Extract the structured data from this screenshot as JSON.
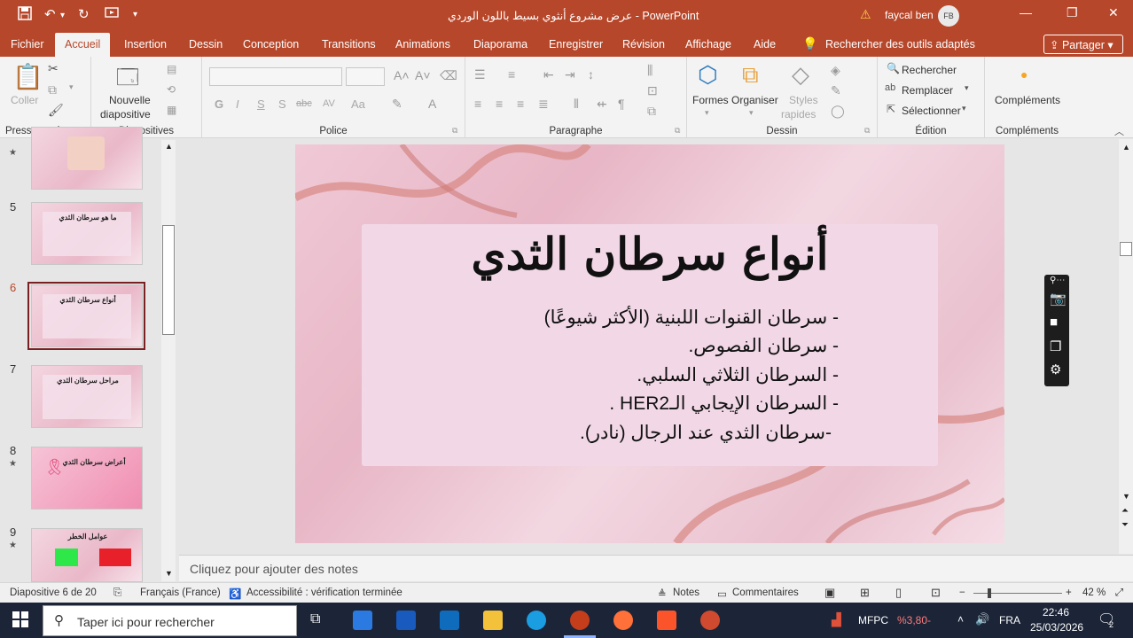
{
  "title_bar": {
    "title": "عرض مشروع أنثوي بسيط باللون الوردي  -  PowerPoint",
    "user_name": "faycal ben",
    "avatar_initials": "FB",
    "icons": [
      "save-icon",
      "undo-icon",
      "redo-icon",
      "present-icon",
      "customize-icon",
      "warning-icon",
      "minimize-icon",
      "restore-icon",
      "close-icon"
    ]
  },
  "tabs": {
    "items": [
      "Fichier",
      "Accueil",
      "Insertion",
      "Dessin",
      "Conception",
      "Transitions",
      "Animations",
      "Diaporama",
      "Enregistrer",
      "Révision",
      "Affichage",
      "Aide"
    ],
    "active": "Accueil",
    "search": "Rechercher des outils adaptés",
    "share": "Partager"
  },
  "ribbon": {
    "clipboard": {
      "paste": "Coller",
      "label": "Presse-papiers"
    },
    "slides": {
      "new_slide_line1": "Nouvelle",
      "new_slide_line2": "diapositive",
      "label": "Diapositives"
    },
    "font": {
      "bold": "G",
      "italic": "I",
      "underline": "S",
      "shadow": "S",
      "strike": "abc",
      "spacing": "AV",
      "case": "Aa",
      "label": "Police"
    },
    "paragraph": {
      "label": "Paragraphe"
    },
    "drawing": {
      "shapes": "Formes",
      "arrange": "Organiser",
      "quick_styles_1": "Styles",
      "quick_styles_2": "rapides",
      "label": "Dessin"
    },
    "editing": {
      "find": "Rechercher",
      "replace": "Remplacer",
      "select": "Sélectionner",
      "label": "Édition"
    },
    "addins": {
      "addins": "Compléments",
      "label": "Compléments"
    }
  },
  "thumbnails": [
    {
      "num": "",
      "title": "",
      "star": true
    },
    {
      "num": "5",
      "title": "ما هو سرطان الثدي",
      "star": false
    },
    {
      "num": "6",
      "title": "أنواع سرطان الثدي",
      "star": false,
      "selected": true
    },
    {
      "num": "7",
      "title": "مراحل سرطان الثدي",
      "star": false
    },
    {
      "num": "8",
      "title": "أعراض سرطان الثدي",
      "star": true
    },
    {
      "num": "9",
      "title": "عوامل الخطر",
      "star": true
    }
  ],
  "slide": {
    "title": "أنواع سرطان الثدي",
    "bullets": [
      "- سرطان القنوات اللبنية (الأكثر شيوعًا)",
      "- سرطان الفصوص.",
      "- السرطان الثلاثي السلبي.",
      "- السرطان الإيجابي الـHER2 .",
      "-سرطان الثدي عند الرجال (نادر)."
    ]
  },
  "notes": {
    "placeholder": "Cliquez pour ajouter des notes"
  },
  "status": {
    "slide_count": "Diapositive 6 de 20",
    "language": "Français (France)",
    "accessibility": "Accessibilité : vérification terminée",
    "notes": "Notes",
    "comments": "Commentaires",
    "zoom": "42 %"
  },
  "taskbar": {
    "search_placeholder": "Taper ici pour rechercher",
    "stock_name": "MFPC",
    "stock_change": "%3,80-",
    "lang": "FRA",
    "time": "22:46",
    "date": "25/03/2026",
    "notif_count": "2"
  },
  "colors": {
    "accent": "#b7472a",
    "slide_pink": "#f2d8e6",
    "taskbar": "#1c2538"
  }
}
